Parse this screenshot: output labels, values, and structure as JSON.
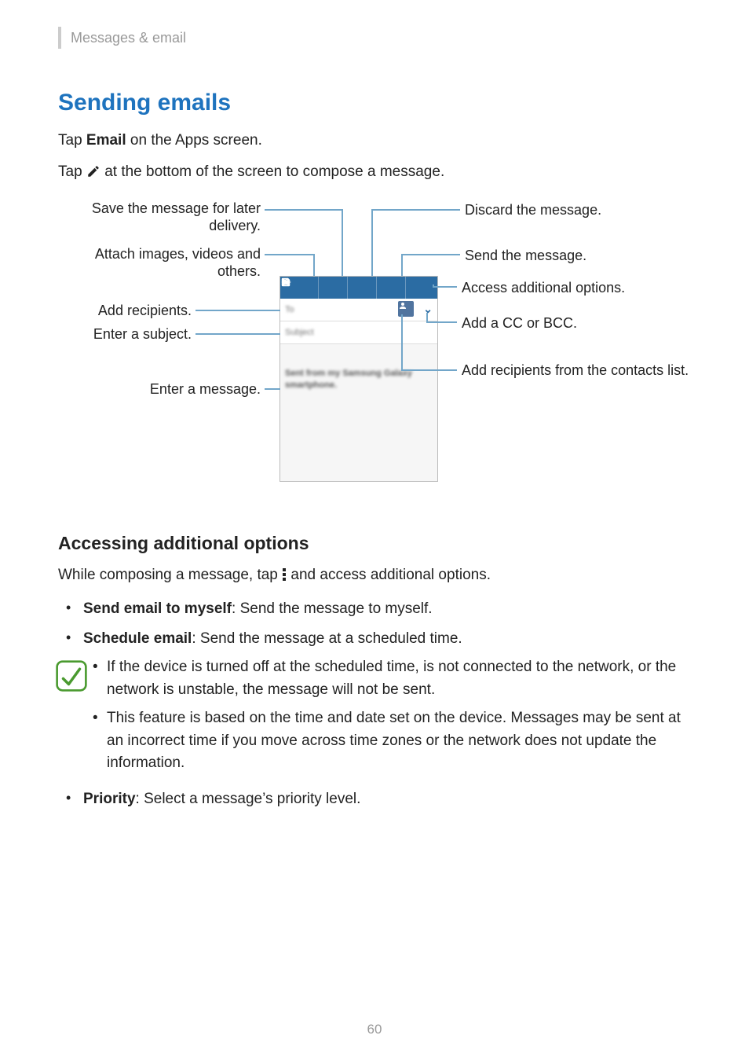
{
  "header": {
    "section": "Messages & email"
  },
  "title": "Sending emails",
  "intro": {
    "line1_before": "Tap ",
    "line1_bold": "Email",
    "line1_after": " on the Apps screen.",
    "line2_before": "Tap ",
    "line2_after": " at the bottom of the screen to compose a message."
  },
  "callouts": {
    "save": "Save the message for later delivery.",
    "attach": "Attach images, videos and others.",
    "add_recipients": "Add recipients.",
    "enter_subject": "Enter a subject.",
    "enter_message": "Enter a message.",
    "discard": "Discard the message.",
    "send": "Send the message.",
    "more": "Access additional options.",
    "ccbcc": "Add a CC or BCC.",
    "contacts": "Add recipients from the contacts list."
  },
  "phone": {
    "to_label": "To",
    "subject_label": "Subject",
    "signature": "Sent from my Samsung Galaxy smartphone."
  },
  "sub_heading": "Accessing additional options",
  "sub_intro_before": "While composing a message, tap ",
  "sub_intro_after": " and access additional options.",
  "options": {
    "self_bold": "Send email to myself",
    "self_rest": ": Send the message to myself.",
    "schedule_bold": "Schedule email",
    "schedule_rest": ": Send the message at a scheduled time.",
    "priority_bold": "Priority",
    "priority_rest": ": Select a message’s priority level."
  },
  "notes": {
    "n1": "If the device is turned off at the scheduled time, is not connected to the network, or the network is unstable, the message will not be sent.",
    "n2": "This feature is based on the time and date set on the device. Messages may be sent at an incorrect time if you move across time zones or the network does not update the information."
  },
  "page_number": "60"
}
